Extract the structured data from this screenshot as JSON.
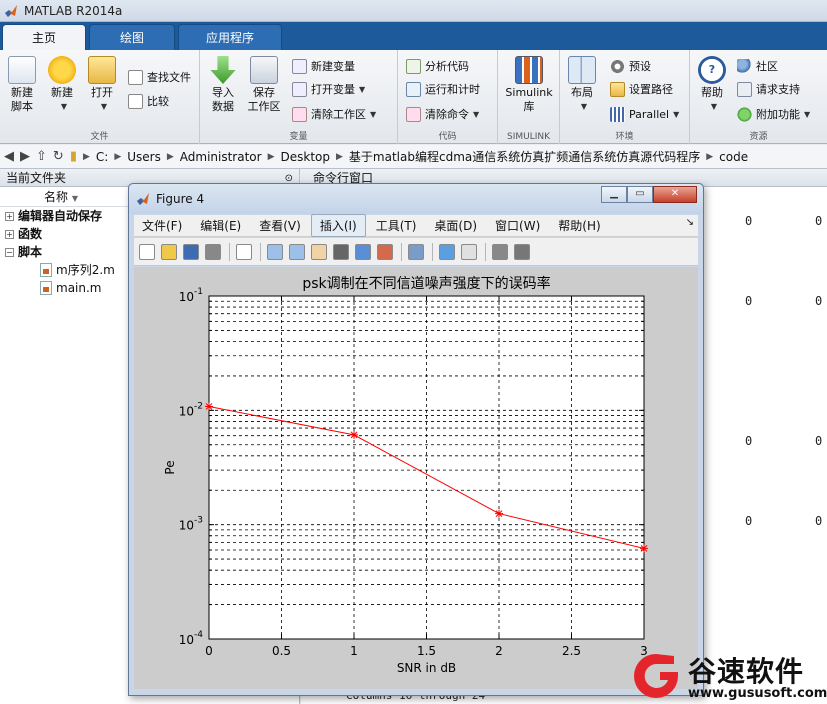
{
  "app": {
    "title": "MATLAB R2014a"
  },
  "tabs": [
    {
      "label": "主页"
    },
    {
      "label": "绘图"
    },
    {
      "label": "应用程序"
    }
  ],
  "ribbon": {
    "file_group": {
      "label": "文件",
      "new_script": "新建\n脚本",
      "new": "新建",
      "open": "打开",
      "find_files": "查找文件",
      "compare": "比较"
    },
    "variable_group": {
      "label": "变量",
      "import_data": "导入\n数据",
      "save_workspace": "保存\n工作区",
      "new_variable": "新建变量",
      "open_variable": "打开变量",
      "clear_workspace": "清除工作区"
    },
    "code_group": {
      "label": "代码",
      "analyze_code": "分析代码",
      "run_and_time": "运行和计时",
      "clear_commands": "清除命令"
    },
    "simulink_group": {
      "label": "SIMULINK",
      "simulink_library": "Simulink\n库"
    },
    "environment_group": {
      "label": "环境",
      "layout": "布局",
      "preferences": "预设",
      "set_path": "设置路径",
      "parallel": "Parallel"
    },
    "resources_group": {
      "label": "资源",
      "help": "帮助",
      "community": "社区",
      "request_support": "请求支持",
      "add_ons": "附加功能"
    }
  },
  "address": {
    "crumbs": [
      "C:",
      "Users",
      "Administrator",
      "Desktop",
      "基于matlab编程cdma通信系统仿真扩频通信系统仿真源代码程序",
      "code"
    ]
  },
  "file_panel": {
    "title": "当前文件夹",
    "column_name": "名称",
    "sort_indicator": "▼",
    "items": [
      {
        "label": "编辑器自动保存",
        "expander": "+"
      },
      {
        "label": "函数",
        "expander": "+"
      },
      {
        "label": "脚本",
        "expander": "−"
      }
    ],
    "files": [
      {
        "label": "m序列2.m"
      },
      {
        "label": "main.m"
      }
    ]
  },
  "command_window": {
    "title": "命令行窗口",
    "values": [
      "0",
      "0",
      "0",
      "0",
      "0",
      "0",
      "0",
      "0"
    ],
    "footer": "Columns 16 through 24"
  },
  "figure": {
    "title": "Figure 4",
    "menus": [
      "文件(F)",
      "编辑(E)",
      "查看(V)",
      "插入(I)",
      "工具(T)",
      "桌面(D)",
      "窗口(W)",
      "帮助(H)"
    ],
    "toolbar_icons": [
      "new-figure-icon",
      "open-file-icon",
      "save-icon",
      "print-icon",
      "pointer-icon",
      "zoom-in-icon",
      "zoom-out-icon",
      "pan-hand-icon",
      "rotate-3d-icon",
      "data-cursor-icon",
      "brush-icon",
      "link-plot-icon",
      "colorbar-icon",
      "legend-icon",
      "hide-plot-tools-icon",
      "show-plot-tools-icon"
    ]
  },
  "chart_data": {
    "type": "line",
    "title": "psk调制在不同信道噪声强度下的误码率",
    "xlabel": "SNR in dB",
    "ylabel": "Pe",
    "xlim": [
      0,
      3
    ],
    "ylim": [
      0.0001,
      0.1
    ],
    "yscale": "log",
    "xticks": [
      "0",
      "0.5",
      "1",
      "1.5",
      "2",
      "2.5",
      "3"
    ],
    "yticks": [
      {
        "base": "10",
        "exp": "-1",
        "value": 0.1
      },
      {
        "base": "10",
        "exp": "-2",
        "value": 0.01
      },
      {
        "base": "10",
        "exp": "-3",
        "value": 0.001
      },
      {
        "base": "10",
        "exp": "-4",
        "value": 0.0001
      }
    ],
    "grid": true,
    "series": [
      {
        "color": "#ff0000",
        "marker": "*",
        "x": [
          0,
          1,
          2,
          3
        ],
        "y": [
          0.0108,
          0.0061,
          0.00125,
          0.00062
        ]
      }
    ]
  },
  "watermark": {
    "name": "谷速软件",
    "url": "www.gususoft.com"
  },
  "colors": {
    "ribbon_tab_bar": "#1d5a9c",
    "plot_line": "#ff0000",
    "figure_bg": "#cccccc"
  }
}
